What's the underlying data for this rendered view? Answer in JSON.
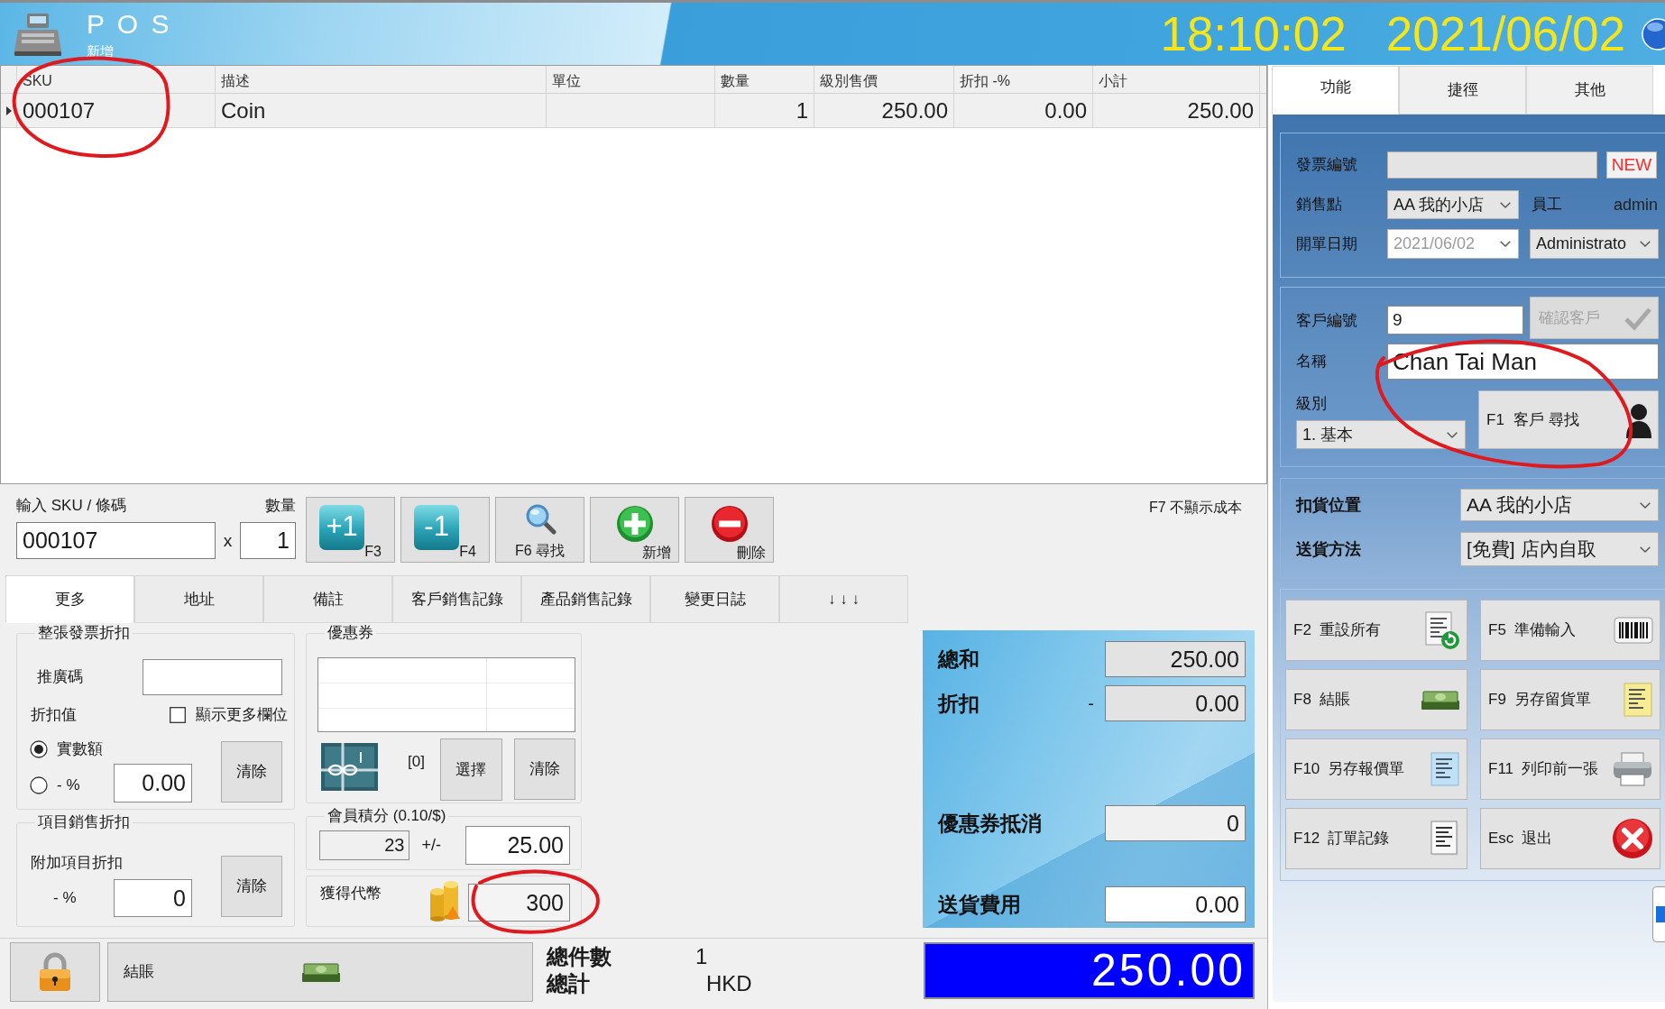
{
  "header": {
    "title": "P O S",
    "subtitle": "新增",
    "time": "18:10:02",
    "date": "2021/06/02"
  },
  "items_table": {
    "columns": [
      "SKU",
      "描述",
      "單位",
      "數量",
      "級別售價",
      "折扣 -%",
      "小計"
    ],
    "rows": [
      {
        "sku": "000107",
        "description": "Coin",
        "quantity": "1",
        "price": "250.00",
        "discount": "0.00",
        "subtotal": "250.00",
        "selected": true
      }
    ]
  },
  "entry": {
    "sku_label": "輸入 SKU / 條碼",
    "sku": "000107",
    "qty_label": "數量",
    "times": "x",
    "qty": "1",
    "cost_toggle": "F7 不顯示成本"
  },
  "entry_buttons": [
    {
      "kind": "increase",
      "badge": "+1",
      "label": "F3"
    },
    {
      "kind": "decrease",
      "badge": "-1",
      "label": "F4"
    },
    {
      "kind": "search",
      "label": "F6 尋找"
    },
    {
      "kind": "add",
      "label": "新增"
    },
    {
      "kind": "delete",
      "label": "刪除"
    }
  ],
  "detail_tabs": [
    {
      "label": "更多",
      "selected": true
    },
    {
      "label": "地址",
      "selected": false
    },
    {
      "label": "備註",
      "selected": false
    },
    {
      "label": "客戶銷售記錄",
      "selected": false
    },
    {
      "label": "產品銷售記錄",
      "selected": false
    },
    {
      "label": "變更日誌",
      "selected": false
    },
    {
      "label": "↓ ↓ ↓",
      "selected": false
    }
  ],
  "invoice_discount": {
    "title": "整張發票折扣",
    "promo_label": "推廣碼",
    "value_label": "折扣值",
    "show_more": {
      "label": "顯示更多欄位",
      "checked": false
    },
    "modes": [
      {
        "label": "實數額",
        "selected": true
      },
      {
        "label": "- %",
        "selected": false
      }
    ],
    "amount": "0.00",
    "clear": "清除"
  },
  "item_discount": {
    "title": "項目銷售折扣",
    "label": "附加項目折扣",
    "percent_label": "- %",
    "value": "0",
    "clear": "清除"
  },
  "coupons": {
    "title": "優惠券",
    "count": "[0]",
    "select": "選擇",
    "clear": "清除"
  },
  "points": {
    "title": "會員積分 (0.10/$)",
    "balance": "23",
    "sign": "+/-",
    "earned": "25.00"
  },
  "tokens": {
    "label": "獲得代幣",
    "value": "300"
  },
  "summary": [
    {
      "kind": "readonly",
      "label": "總和",
      "value": "250.00"
    },
    {
      "kind": "readonly",
      "label": "折扣",
      "prefix": "-",
      "value": "0.00"
    },
    {
      "kind": "plain",
      "label": "優惠券抵消",
      "value": "0"
    },
    {
      "kind": "editable",
      "label": "送貨費用",
      "value": "0.00"
    }
  ],
  "footer": {
    "checkout": "結賬",
    "count_label": "總件數",
    "count": "1",
    "total_label": "總計",
    "currency": "HKD",
    "grand_total": "250.00"
  },
  "side_tabs": [
    {
      "label": "功能",
      "selected": true
    },
    {
      "label": "捷徑",
      "selected": false
    },
    {
      "label": "其他",
      "selected": false
    }
  ],
  "invoice": {
    "number_label": "發票編號",
    "new": "NEW",
    "shop_label": "銷售點",
    "shop": "AA 我的小店",
    "staff_label": "員工",
    "staff": "admin",
    "date_label": "開單日期",
    "date": "2021/06/02",
    "operator": "Administrato"
  },
  "customer": {
    "id_label": "客戶編號",
    "id": "9",
    "confirm": {
      "label": "確認客戶",
      "disabled": true
    },
    "name_label": "名稱",
    "name": "Chan Tai Man",
    "tier_label": "級別",
    "tier": "1. 基本",
    "search_key": "F1",
    "search_label": "客戶 尋找"
  },
  "delivery": {
    "location_label": "扣貨位置",
    "location": "AA 我的小店",
    "method_label": "送貨方法",
    "method": "[免費] 店內自取"
  },
  "actions": [
    {
      "key": "F2",
      "label": "重設所有",
      "kind": "reset"
    },
    {
      "key": "F5",
      "label": "準備輸入",
      "kind": "barcode"
    },
    {
      "key": "F8",
      "label": "結賬",
      "kind": "cash"
    },
    {
      "key": "F9",
      "label": "另存留貨單",
      "kind": "hold"
    },
    {
      "key": "F10",
      "label": "另存報價單",
      "kind": "quote"
    },
    {
      "key": "F11",
      "label": "列印前一張",
      "kind": "print"
    },
    {
      "key": "F12",
      "label": "訂單記錄",
      "kind": "orders"
    },
    {
      "key": "Esc",
      "label": "退出",
      "kind": "exit"
    }
  ]
}
